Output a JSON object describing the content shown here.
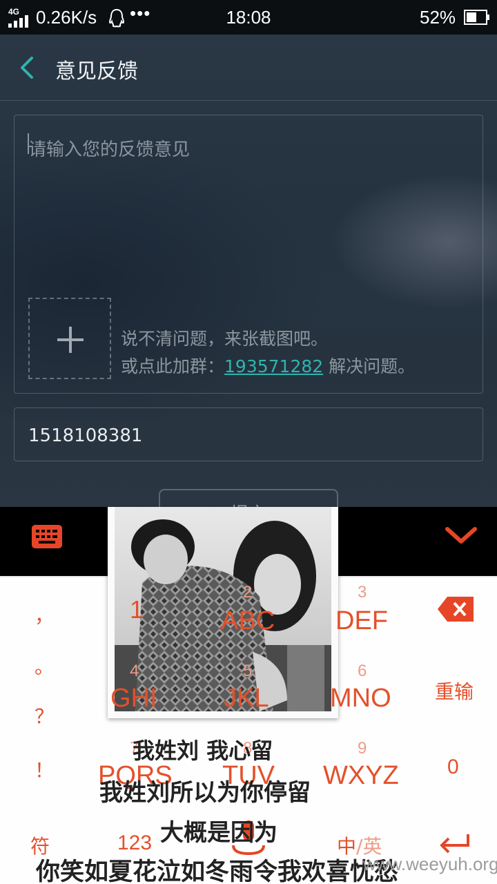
{
  "status_bar": {
    "network": "4G",
    "speed": "0.26K/s",
    "more": "•••",
    "time": "18:08",
    "battery": "52%"
  },
  "header": {
    "title": "意见反馈"
  },
  "feedback": {
    "placeholder": "请输入您的反馈意见",
    "hint_line1": "说不清问题，来张截图吧。",
    "hint_line2_prefix": "或点此加群：",
    "group_number": "193571282",
    "hint_line2_suffix": " 解决问题。"
  },
  "contact": {
    "value": "1518108381"
  },
  "submit": {
    "label": "提交"
  },
  "keyboard": {
    "left_column": [
      "，",
      "。",
      "？",
      "！"
    ],
    "keys": [
      {
        "num": "1",
        "letters": ""
      },
      {
        "num": "2",
        "letters": "ABC"
      },
      {
        "num": "3",
        "letters": "DEF"
      },
      {
        "num": "4",
        "letters": "GHI"
      },
      {
        "num": "5",
        "letters": "JKL"
      },
      {
        "num": "6",
        "letters": "MNO"
      },
      {
        "num": "7",
        "letters": "PQRS"
      },
      {
        "num": "8",
        "letters": "TUV"
      },
      {
        "num": "9",
        "letters": "WXYZ"
      }
    ],
    "retype": "重输",
    "zero": "0",
    "symbols": "符",
    "numbers": "123",
    "lang_zh": "中",
    "lang_sep": "/",
    "lang_en": "英"
  },
  "overlay": {
    "lyrics": [
      "我姓刘  我心留",
      "我姓刘所以为你停留",
      "大概是因为",
      "你笑如夏花泣如冬雨令我欢喜忧愁"
    ],
    "watermark": "www.weeyuh.org"
  },
  "colors": {
    "accent_teal": "#2fb4b0",
    "keyboard_red": "#e4502a",
    "status_bar": "#0c0f12"
  },
  "icons": [
    "signal-icon",
    "qq-icon",
    "battery-icon",
    "back-icon",
    "add-icon",
    "keyboard-icon",
    "collapse-icon",
    "backspace-icon",
    "mic-icon",
    "enter-icon"
  ]
}
